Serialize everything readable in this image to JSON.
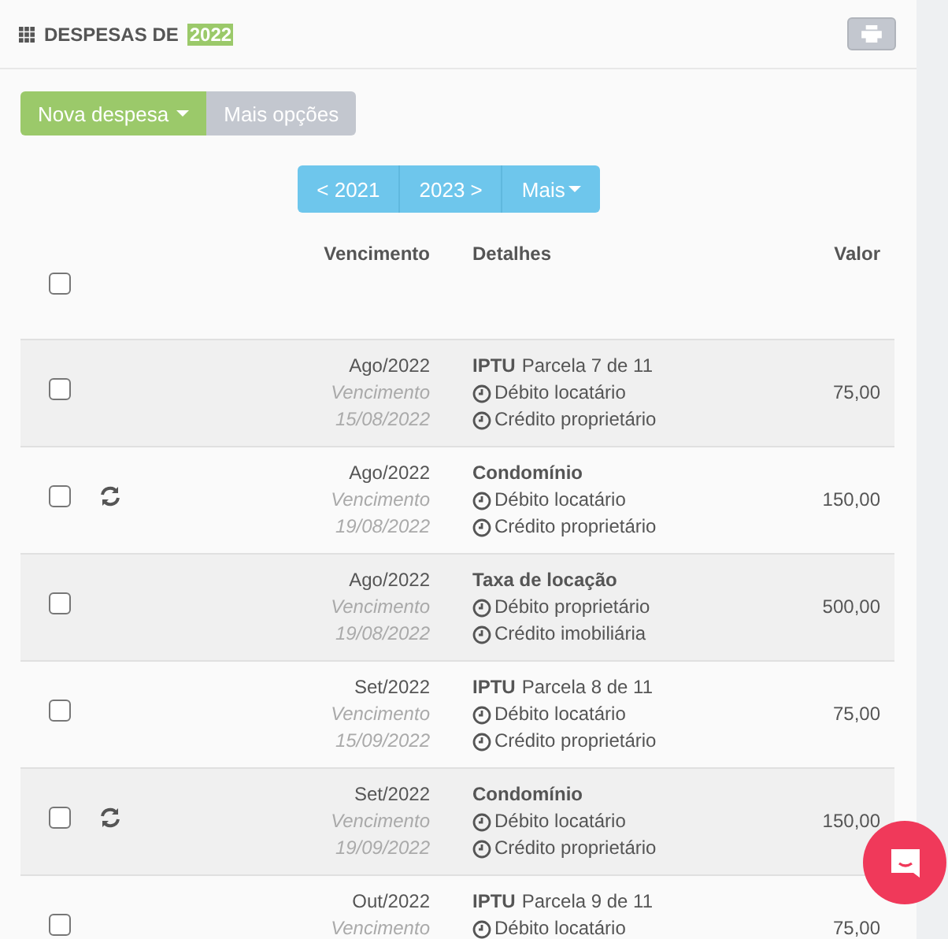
{
  "header": {
    "title": "DESPESAS DE",
    "year": "2022"
  },
  "actions": [
    {
      "label": "Nova despesa",
      "kind": "primary",
      "dropdown": true
    },
    {
      "label": "Mais opções",
      "kind": "secondary",
      "dropdown": false
    }
  ],
  "pager": [
    {
      "label": "< 2021",
      "dropdown": false
    },
    {
      "label": "2023 >",
      "dropdown": false
    },
    {
      "label": "Mais",
      "dropdown": true
    }
  ],
  "table": {
    "columns": [
      "Vencimento",
      "Detalhes",
      "Valor"
    ],
    "all_checked": false,
    "rows": [
      {
        "checked": false,
        "recurring": false,
        "month": "Ago/2022",
        "due_label": "Vencimento",
        "due_date": "15/08/2022",
        "title": "IPTU",
        "subtitle": "Parcela 7 de 11",
        "debit": "Débito locatário",
        "credit": "Crédito proprietário",
        "value": "75,00"
      },
      {
        "checked": false,
        "recurring": true,
        "month": "Ago/2022",
        "due_label": "Vencimento",
        "due_date": "19/08/2022",
        "title": "Condomínio",
        "debit": "Débito locatário",
        "credit": "Crédito proprietário",
        "value": "150,00"
      },
      {
        "checked": false,
        "recurring": false,
        "month": "Ago/2022",
        "due_label": "Vencimento",
        "due_date": "19/08/2022",
        "title": "Taxa de locação",
        "debit": "Débito proprietário",
        "credit": "Crédito imobiliária",
        "value": "500,00"
      },
      {
        "checked": false,
        "recurring": false,
        "month": "Set/2022",
        "due_label": "Vencimento",
        "due_date": "15/09/2022",
        "title": "IPTU",
        "subtitle": "Parcela 8 de 11",
        "debit": "Débito locatário",
        "credit": "Crédito proprietário",
        "value": "75,00"
      },
      {
        "checked": false,
        "recurring": true,
        "month": "Set/2022",
        "due_label": "Vencimento",
        "due_date": "19/09/2022",
        "title": "Condomínio",
        "debit": "Débito locatário",
        "credit": "Crédito proprietário",
        "value": "150,00"
      },
      {
        "checked": false,
        "recurring": false,
        "month": "Out/2022",
        "due_label": "Vencimento",
        "title": "IPTU",
        "subtitle": "Parcela 9 de 11",
        "debit": "Débito locatário",
        "value": "75,00"
      }
    ]
  }
}
